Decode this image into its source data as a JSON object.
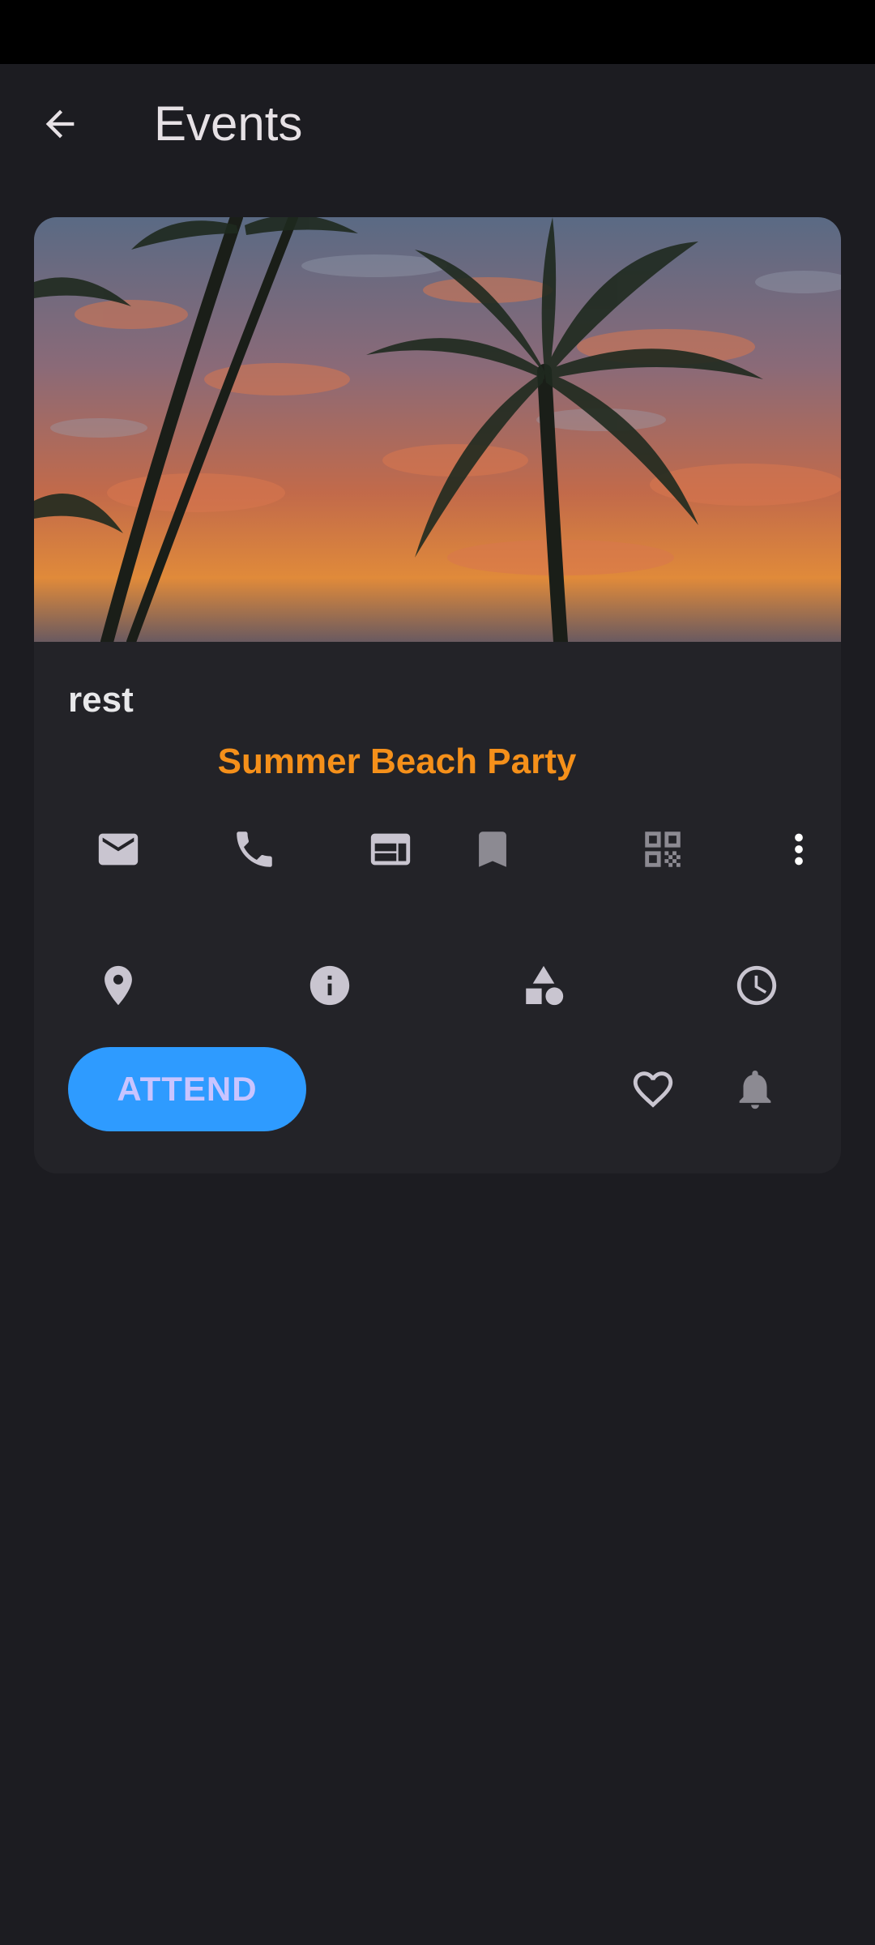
{
  "app_bar": {
    "title": "Events",
    "back_icon": "arrow-back-icon"
  },
  "event": {
    "name": "rest",
    "title": "Summer Beach Party",
    "image": "palm-trees-sunset-image",
    "title_color": "#f5901a"
  },
  "actions_row1": [
    "email-icon",
    "phone-icon",
    "web-icon",
    "bookmark-icon",
    "qr-code-icon",
    "more-vert-icon"
  ],
  "actions_row2": [
    "location-pin-icon",
    "info-icon",
    "category-icon",
    "clock-icon"
  ],
  "attend_button": {
    "label": "ATTEND",
    "color": "#2e9bff"
  },
  "secondary_actions": [
    "favorite-icon",
    "notification-bell-icon"
  ]
}
